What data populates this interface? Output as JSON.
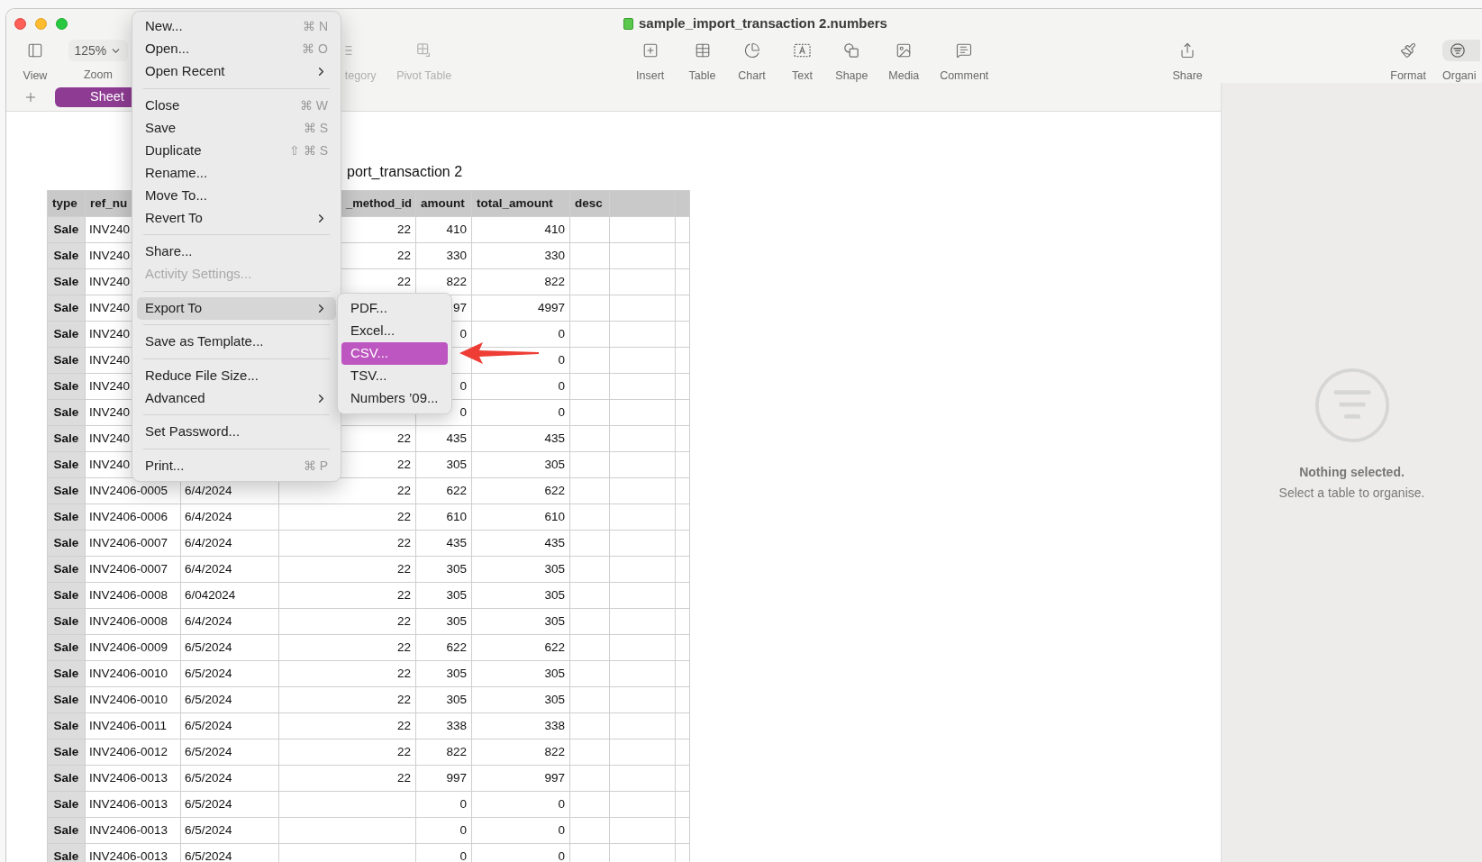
{
  "window": {
    "title": "sample_import_transaction 2.numbers"
  },
  "toolbar": [
    {
      "kind": "button",
      "label": "View",
      "disabled": false
    },
    {
      "kind": "dropdown",
      "value": "125%",
      "label": "Zoom",
      "disabled": false
    },
    {
      "kind": "button",
      "label": "tegory",
      "disabled": true
    },
    {
      "kind": "button",
      "label": "Pivot Table",
      "disabled": true
    },
    {
      "kind": "button",
      "label": "Insert",
      "disabled": false
    },
    {
      "kind": "button",
      "label": "Table",
      "disabled": false
    },
    {
      "kind": "button",
      "label": "Chart",
      "disabled": false
    },
    {
      "kind": "button",
      "label": "Text",
      "disabled": false
    },
    {
      "kind": "button",
      "label": "Shape",
      "disabled": false
    },
    {
      "kind": "button",
      "label": "Media",
      "disabled": false
    },
    {
      "kind": "button",
      "label": "Comment",
      "disabled": false
    },
    {
      "kind": "button",
      "label": "Share",
      "disabled": false
    },
    {
      "kind": "button",
      "label": "Format",
      "disabled": false
    },
    {
      "kind": "button",
      "label": "Organi",
      "disabled": false
    }
  ],
  "sheet_tabs": [
    {
      "label": "Sheet",
      "selected": true
    }
  ],
  "table": {
    "title": "port_transaction 2",
    "columns": [
      "type",
      "ref_nu",
      null,
      "_method_id",
      "amount",
      "total_amount",
      "desc",
      null,
      null
    ],
    "rows": [
      {
        "cells": [
          "Sale",
          "INV240",
          null,
          "22",
          "410",
          "410"
        ]
      },
      {
        "cells": [
          "Sale",
          "INV240",
          null,
          "22",
          "330",
          "330"
        ]
      },
      {
        "cells": [
          "Sale",
          "INV240",
          null,
          "22",
          "822",
          "822"
        ]
      },
      {
        "cells": [
          "Sale",
          "INV240",
          null,
          null,
          "97",
          "4997"
        ]
      },
      {
        "cells": [
          "Sale",
          "INV240",
          null,
          null,
          "0",
          "0"
        ]
      },
      {
        "cells": [
          "Sale",
          "INV240",
          null,
          null,
          null,
          "0"
        ]
      },
      {
        "cells": [
          "Sale",
          "INV240",
          null,
          null,
          "0",
          "0"
        ]
      },
      {
        "cells": [
          "Sale",
          "INV240",
          null,
          null,
          "0",
          "0"
        ]
      },
      {
        "cells": [
          "Sale",
          "INV240",
          null,
          "22",
          "435",
          "435"
        ]
      },
      {
        "cells": [
          "Sale",
          "INV240",
          null,
          "22",
          "305",
          "305"
        ]
      },
      {
        "cells": [
          "Sale",
          "INV2406-0005",
          "6/4/2024",
          "22",
          "622",
          "622"
        ]
      },
      {
        "cells": [
          "Sale",
          "INV2406-0006",
          "6/4/2024",
          "22",
          "610",
          "610"
        ]
      },
      {
        "cells": [
          "Sale",
          "INV2406-0007",
          "6/4/2024",
          "22",
          "435",
          "435"
        ]
      },
      {
        "cells": [
          "Sale",
          "INV2406-0007",
          "6/4/2024",
          "22",
          "305",
          "305"
        ]
      },
      {
        "cells": [
          "Sale",
          "INV2406-0008",
          "6/042024",
          "22",
          "305",
          "305"
        ]
      },
      {
        "cells": [
          "Sale",
          "INV2406-0008",
          "6/4/2024",
          "22",
          "305",
          "305"
        ]
      },
      {
        "cells": [
          "Sale",
          "INV2406-0009",
          "6/5/2024",
          "22",
          "622",
          "622"
        ]
      },
      {
        "cells": [
          "Sale",
          "INV2406-0010",
          "6/5/2024",
          "22",
          "305",
          "305"
        ]
      },
      {
        "cells": [
          "Sale",
          "INV2406-0010",
          "6/5/2024",
          "22",
          "305",
          "305"
        ]
      },
      {
        "cells": [
          "Sale",
          "INV2406-0011",
          "6/5/2024",
          "22",
          "338",
          "338"
        ]
      },
      {
        "cells": [
          "Sale",
          "INV2406-0012",
          "6/5/2024",
          "22",
          "822",
          "822"
        ]
      },
      {
        "cells": [
          "Sale",
          "INV2406-0013",
          "6/5/2024",
          "22",
          "997",
          "997"
        ]
      },
      {
        "cells": [
          "Sale",
          "INV2406-0013",
          "6/5/2024",
          null,
          "0",
          "0"
        ]
      },
      {
        "cells": [
          "Sale",
          "INV2406-0013",
          "6/5/2024",
          null,
          "0",
          "0"
        ]
      },
      {
        "cells": [
          "Sale",
          "INV2406-0013",
          "6/5/2024",
          null,
          "0",
          "0"
        ]
      }
    ]
  },
  "file_menu": [
    {
      "kind": "item",
      "label": "New...",
      "shortcut": "⌘ N",
      "submenu": false,
      "disabled": false,
      "selected": false
    },
    {
      "kind": "item",
      "label": "Open...",
      "shortcut": "⌘ O",
      "submenu": false,
      "disabled": false,
      "selected": false
    },
    {
      "kind": "item",
      "label": "Open Recent",
      "submenu": true,
      "disabled": false,
      "selected": false
    },
    {
      "kind": "separator"
    },
    {
      "kind": "item",
      "label": "Close",
      "shortcut": "⌘ W",
      "submenu": false,
      "disabled": false,
      "selected": false
    },
    {
      "kind": "item",
      "label": "Save",
      "shortcut": "⌘ S",
      "submenu": false,
      "disabled": false,
      "selected": false
    },
    {
      "kind": "item",
      "label": "Duplicate",
      "shortcut": "⇧ ⌘ S",
      "submenu": false,
      "disabled": false,
      "selected": false
    },
    {
      "kind": "item",
      "label": "Rename...",
      "submenu": false,
      "disabled": false,
      "selected": false
    },
    {
      "kind": "item",
      "label": "Move To...",
      "submenu": false,
      "disabled": false,
      "selected": false
    },
    {
      "kind": "item",
      "label": "Revert To",
      "submenu": true,
      "disabled": false,
      "selected": false
    },
    {
      "kind": "separator"
    },
    {
      "kind": "item",
      "label": "Share...",
      "submenu": false,
      "disabled": false,
      "selected": false
    },
    {
      "kind": "item",
      "label": "Activity Settings...",
      "submenu": false,
      "disabled": true,
      "selected": false
    },
    {
      "kind": "separator"
    },
    {
      "kind": "item",
      "label": "Export To",
      "submenu": true,
      "disabled": false,
      "selected": true
    },
    {
      "kind": "separator"
    },
    {
      "kind": "item",
      "label": "Save as Template...",
      "submenu": false,
      "disabled": false,
      "selected": false
    },
    {
      "kind": "separator"
    },
    {
      "kind": "item",
      "label": "Reduce File Size...",
      "submenu": false,
      "disabled": false,
      "selected": false
    },
    {
      "kind": "item",
      "label": "Advanced",
      "submenu": true,
      "disabled": false,
      "selected": false
    },
    {
      "kind": "separator"
    },
    {
      "kind": "item",
      "label": "Set Password...",
      "submenu": false,
      "disabled": false,
      "selected": false
    },
    {
      "kind": "separator"
    },
    {
      "kind": "item",
      "label": "Print...",
      "shortcut": "⌘ P",
      "submenu": false,
      "disabled": false,
      "selected": false
    }
  ],
  "export_submenu": [
    {
      "label": "PDF...",
      "selected": false
    },
    {
      "label": "Excel...",
      "selected": false
    },
    {
      "label": "CSV...",
      "selected": true
    },
    {
      "label": "TSV...",
      "selected": false
    },
    {
      "label": "Numbers ’09...",
      "selected": false
    }
  ],
  "organise_panel": {
    "title": "Nothing selected.",
    "message": "Select a table to organise."
  }
}
